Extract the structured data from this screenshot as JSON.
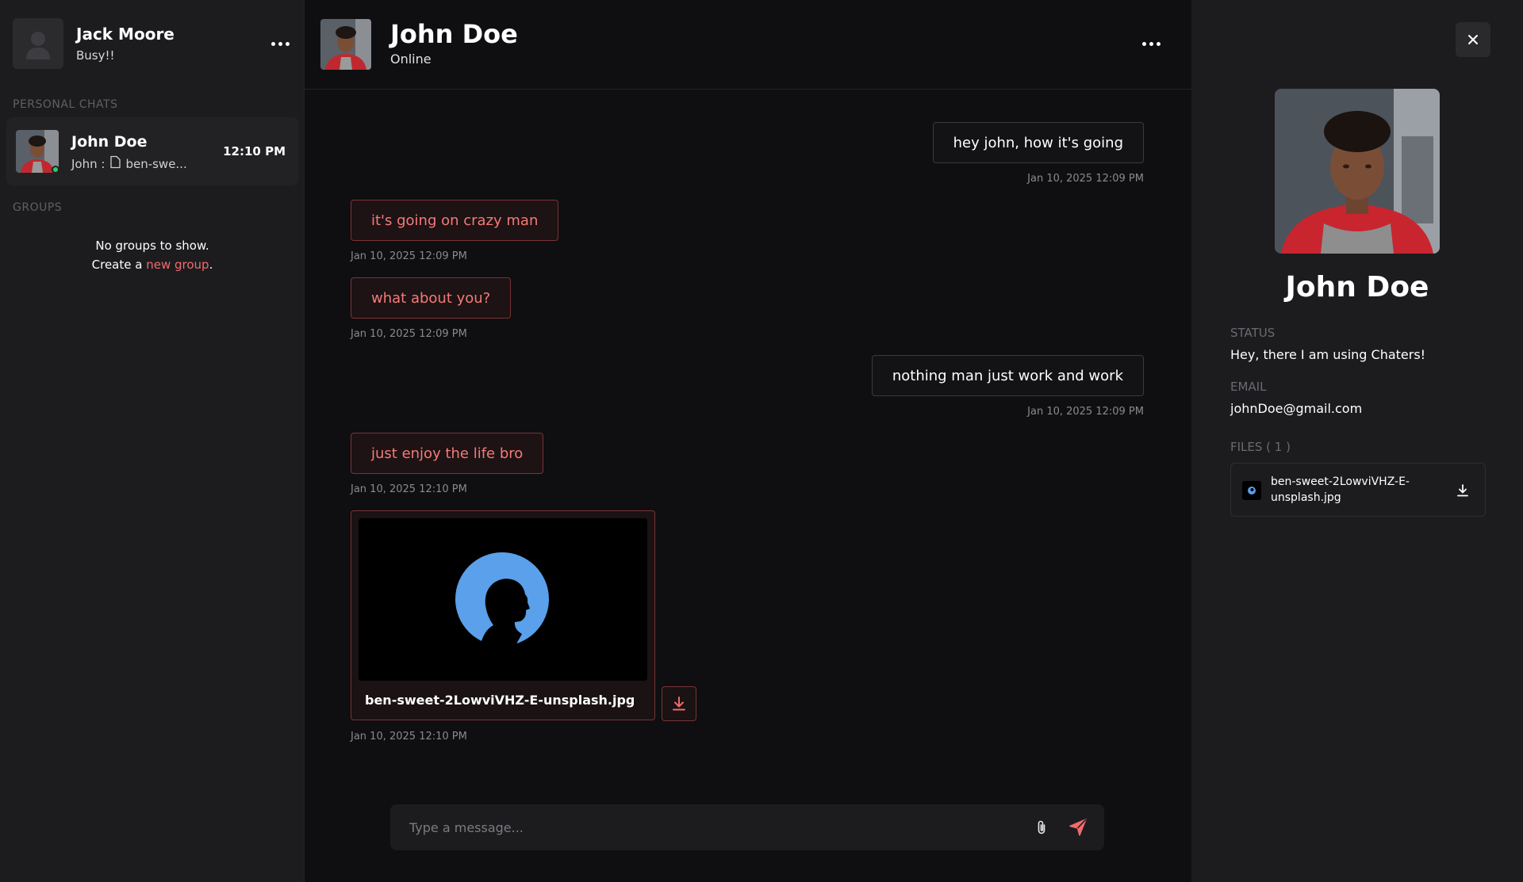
{
  "current_user": {
    "name": "Jack Moore",
    "status": "Busy!!"
  },
  "sidebar": {
    "personal_chats_label": "PERSONAL CHATS",
    "groups_label": "GROUPS",
    "chats": [
      {
        "name": "John Doe",
        "preview_sender": "John :",
        "preview_text": "ben-swe...",
        "time": "12:10 PM",
        "online": true
      }
    ],
    "no_groups_text": "No groups to show.",
    "create_prefix": "Create a",
    "create_link": "new group",
    "create_suffix": "."
  },
  "conversation": {
    "contact_name": "John Doe",
    "contact_status": "Online",
    "messages": [
      {
        "direction": "out",
        "text": "hey john, how it's going",
        "time": "Jan 10, 2025 12:09 PM"
      },
      {
        "direction": "in",
        "text": "it's going on crazy man",
        "time": "Jan 10, 2025 12:09 PM"
      },
      {
        "direction": "in",
        "text": "what about you?",
        "time": "Jan 10, 2025 12:09 PM"
      },
      {
        "direction": "out",
        "text": "nothing man just work and work",
        "time": "Jan 10, 2025 12:09 PM"
      },
      {
        "direction": "in",
        "text": "just enjoy the life bro",
        "time": "Jan 10, 2025 12:10 PM"
      },
      {
        "direction": "in",
        "type": "file",
        "file_name": "ben-sweet-2LowviVHZ-E-unsplash.jpg",
        "time": "Jan 10, 2025 12:10 PM"
      }
    ],
    "composer_placeholder": "Type a message..."
  },
  "profile": {
    "name": "John Doe",
    "status_label": "STATUS",
    "status_value": "Hey, there I am using Chaters!",
    "email_label": "EMAIL",
    "email_value": "johnDoe@gmail.com",
    "files_label": "FILES ( 1 )",
    "files": [
      {
        "name": "ben-sweet-2LowviVHZ-E-unsplash.jpg"
      }
    ]
  },
  "colors": {
    "accent": "#f16b6b",
    "incoming_text": "#f37b78",
    "online": "#2ecc71",
    "panel": "#1c1c1f",
    "background": "#0f0f11"
  },
  "icons": [
    "user-placeholder-icon",
    "more-options-icon",
    "file-icon",
    "download-icon",
    "attach-icon",
    "send-icon",
    "close-icon"
  ]
}
